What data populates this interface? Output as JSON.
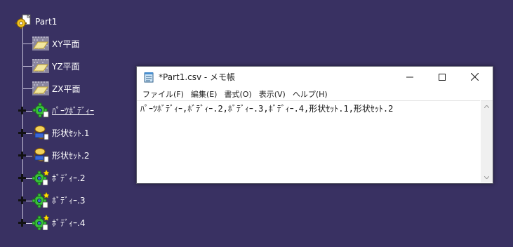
{
  "tree": {
    "root": {
      "label": "Part1",
      "icon": "part-document-icon"
    },
    "items": [
      {
        "label": "XY平面",
        "icon": "plane-icon",
        "expandable": false,
        "underline": false
      },
      {
        "label": "YZ平面",
        "icon": "plane-icon",
        "expandable": false,
        "underline": false
      },
      {
        "label": "ZX平面",
        "icon": "plane-icon",
        "expandable": false,
        "underline": false
      },
      {
        "label": "ﾊﾟｰﾂﾎﾞﾃﾞｨｰ",
        "icon": "part-body-gear-icon",
        "expandable": true,
        "underline": true
      },
      {
        "label": "形状ｾｯﾄ.1",
        "icon": "geometrical-set-icon",
        "expandable": true,
        "underline": false
      },
      {
        "label": "形状ｾｯﾄ.2",
        "icon": "geometrical-set-icon",
        "expandable": true,
        "underline": false
      },
      {
        "label": "ﾎﾞﾃﾞｨｰ.2",
        "icon": "body-gear-icon",
        "expandable": true,
        "underline": false
      },
      {
        "label": "ﾎﾞﾃﾞｨｰ.3",
        "icon": "body-gear-icon",
        "expandable": true,
        "underline": false
      },
      {
        "label": "ﾎﾞﾃﾞｨｰ.4",
        "icon": "body-gear-icon",
        "expandable": true,
        "underline": false
      }
    ]
  },
  "notepad": {
    "title": "*Part1.csv - メモ帳",
    "menu": [
      {
        "label": "ファイル(F)"
      },
      {
        "label": "編集(E)"
      },
      {
        "label": "書式(O)"
      },
      {
        "label": "表示(V)"
      },
      {
        "label": "ヘルプ(H)"
      }
    ],
    "content": "ﾊﾟｰﾂﾎﾞﾃﾞｨｰ,ﾎﾞﾃﾞｨｰ.2,ﾎﾞﾃﾞｨｰ.3,ﾎﾞﾃﾞｨｰ.4,形状ｾｯﾄ.1,形状ｾｯﾄ.2",
    "controls": [
      "minimize-icon",
      "maximize-icon",
      "close-icon"
    ]
  },
  "colors": {
    "background": "#393162",
    "tree_line": "#c9c4dc",
    "tree_text": "#ffffff"
  }
}
